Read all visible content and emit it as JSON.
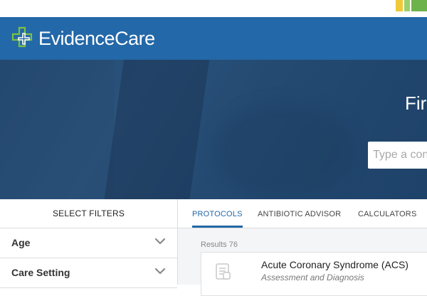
{
  "brand": {
    "name": "EvidenceCare",
    "accent": "#2368a8",
    "logo_icon": "cross-logo-icon"
  },
  "hero": {
    "title": "Fir",
    "search_placeholder": "Type a con"
  },
  "filters": {
    "heading": "SELECT FILTERS",
    "items": [
      {
        "label": "Age",
        "icon": "chevron-down-icon"
      },
      {
        "label": "Care Setting",
        "icon": "chevron-down-icon"
      }
    ]
  },
  "tabs": [
    {
      "label": "PROTOCOLS",
      "active": true
    },
    {
      "label": "ANTIBIOTIC ADVISOR",
      "active": false
    },
    {
      "label": "CALCULATORS",
      "active": false
    }
  ],
  "results": {
    "label": "Results 76",
    "items": [
      {
        "title": "Acute Coronary Syndrome (ACS)",
        "subtitle": "Assessment and Diagnosis",
        "icon": "document-icon"
      }
    ]
  }
}
